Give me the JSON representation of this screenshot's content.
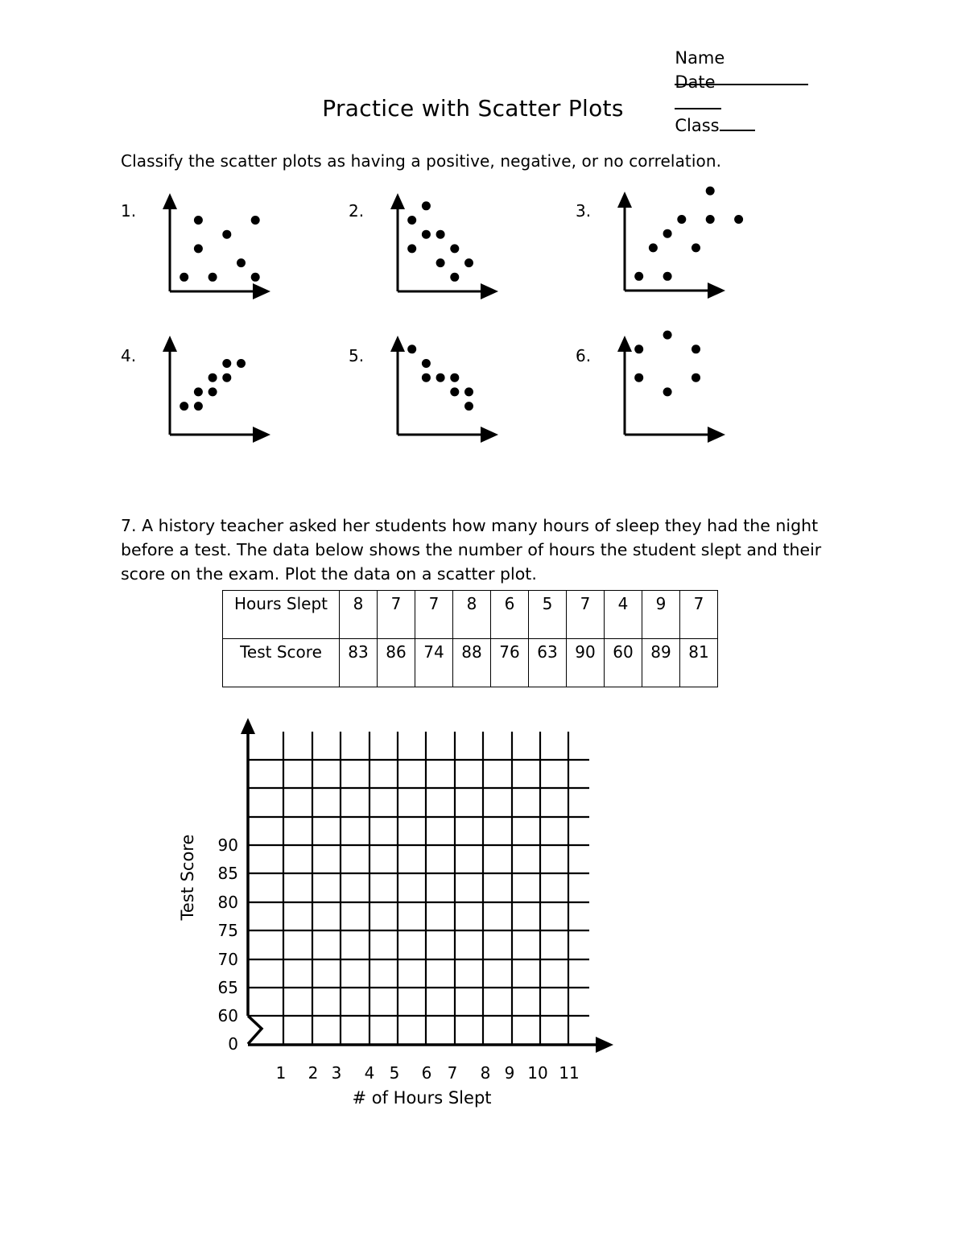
{
  "header": {
    "name_label": "Name",
    "date_label": "Date",
    "class_label": "Class"
  },
  "title": "Practice with Scatter Plots",
  "instructions": "Classify the scatter plots as having a positive, negative, or no correlation.",
  "mini_plots": [
    {
      "label": "1.",
      "points": [
        [
          2,
          5
        ],
        [
          6,
          5
        ],
        [
          4,
          4
        ],
        [
          2,
          3
        ],
        [
          5,
          2
        ],
        [
          1,
          1
        ],
        [
          3,
          1
        ],
        [
          6,
          1
        ]
      ]
    },
    {
      "label": "2.",
      "points": [
        [
          2,
          6
        ],
        [
          1,
          5
        ],
        [
          2,
          4
        ],
        [
          3,
          4
        ],
        [
          1,
          3
        ],
        [
          4,
          3
        ],
        [
          3,
          2
        ],
        [
          5,
          2
        ],
        [
          4,
          1
        ]
      ]
    },
    {
      "label": "3.",
      "points": [
        [
          6,
          7
        ],
        [
          4,
          5
        ],
        [
          6,
          5
        ],
        [
          8,
          5
        ],
        [
          3,
          4
        ],
        [
          2,
          3
        ],
        [
          5,
          3
        ],
        [
          1,
          1
        ],
        [
          3,
          1
        ]
      ]
    },
    {
      "label": "4.",
      "points": [
        [
          4,
          5
        ],
        [
          5,
          5
        ],
        [
          3,
          4
        ],
        [
          4,
          4
        ],
        [
          2,
          3
        ],
        [
          3,
          3
        ],
        [
          1,
          2
        ],
        [
          2,
          2
        ]
      ]
    },
    {
      "label": "5.",
      "points": [
        [
          1,
          6
        ],
        [
          2,
          5
        ],
        [
          2,
          4
        ],
        [
          3,
          4
        ],
        [
          4,
          4
        ],
        [
          4,
          3
        ],
        [
          5,
          3
        ],
        [
          5,
          2
        ]
      ]
    },
    {
      "label": "6.",
      "points": [
        [
          3,
          7
        ],
        [
          1,
          6
        ],
        [
          5,
          6
        ],
        [
          1,
          4
        ],
        [
          5,
          4
        ],
        [
          3,
          3
        ]
      ]
    }
  ],
  "question7": {
    "text": "7.  A history teacher asked her students how many hours of sleep they had the night before a test. The data below shows the number of hours the student slept and their score on the exam. Plot the data on a scatter plot."
  },
  "table": {
    "row1_label": "Hours Slept",
    "row2_label": "Test Score",
    "hours": [
      "8",
      "7",
      "7",
      "8",
      "6",
      "5",
      "7",
      "4",
      "9",
      "7"
    ],
    "scores": [
      "83",
      "86",
      "74",
      "88",
      "76",
      "63",
      "90",
      "60",
      "89",
      "81"
    ]
  },
  "chart_data": {
    "type": "scatter",
    "title": "",
    "xlabel": "# of Hours Slept",
    "ylabel": "Test Score",
    "x_ticks": [
      "1",
      "2",
      "3",
      "4",
      "5",
      "6",
      "7",
      "8",
      "9",
      "10",
      "11"
    ],
    "y_ticks": [
      "0",
      "60",
      "65",
      "70",
      "75",
      "80",
      "85",
      "90"
    ],
    "xlim": [
      0,
      11
    ],
    "ylim_note": "axis break between 0 and 60",
    "grid": true,
    "points": []
  }
}
